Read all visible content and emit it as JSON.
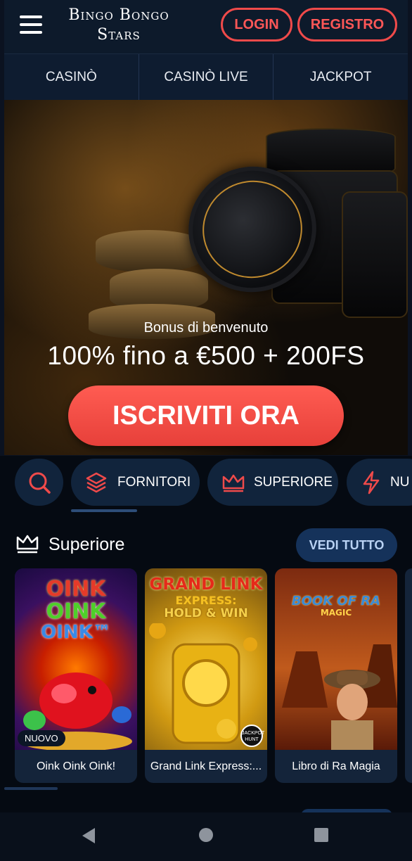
{
  "header": {
    "logo_line1": "Bingo Bongo",
    "logo_line2": "Stars",
    "login_label": "LOGIN",
    "register_label": "REGISTRO"
  },
  "nav": {
    "items": [
      {
        "label": "CASINÒ"
      },
      {
        "label": "CASINÒ LIVE"
      },
      {
        "label": "JACKPOT"
      }
    ]
  },
  "hero": {
    "subtitle": "Bonus di benvenuto",
    "title": "100% fino a €500 + 200FS",
    "cta_label": "ISCRIVITI ORA"
  },
  "filters": {
    "items": [
      {
        "label": "FORNITORI",
        "icon": "layers-icon"
      },
      {
        "label": "SUPERIORE",
        "icon": "crown-icon"
      },
      {
        "label": "NU",
        "icon": "lightning-icon"
      }
    ]
  },
  "section": {
    "title": "Superiore",
    "see_all_label": "VEDI TUTTO",
    "games": [
      {
        "name": "Oink Oink Oink!",
        "badge": "NUOVO",
        "art_lines": [
          "OINK",
          "OINK",
          "OINK™"
        ]
      },
      {
        "name": "Grand Link Express:...",
        "art_lines": [
          "GRAND LINK",
          "EXPRESS:",
          "HOLD & WIN"
        ],
        "corner_badge": "JACKPOT HUNT"
      },
      {
        "name": "Libro di Ra Magia",
        "art_lines": [
          "BOOK OF RA",
          "MAGIC"
        ]
      }
    ]
  },
  "colors": {
    "accent_red": "#ef4a4a",
    "background": "#050a12",
    "pill_bg": "#11243c",
    "see_all_bg": "#15325a"
  }
}
